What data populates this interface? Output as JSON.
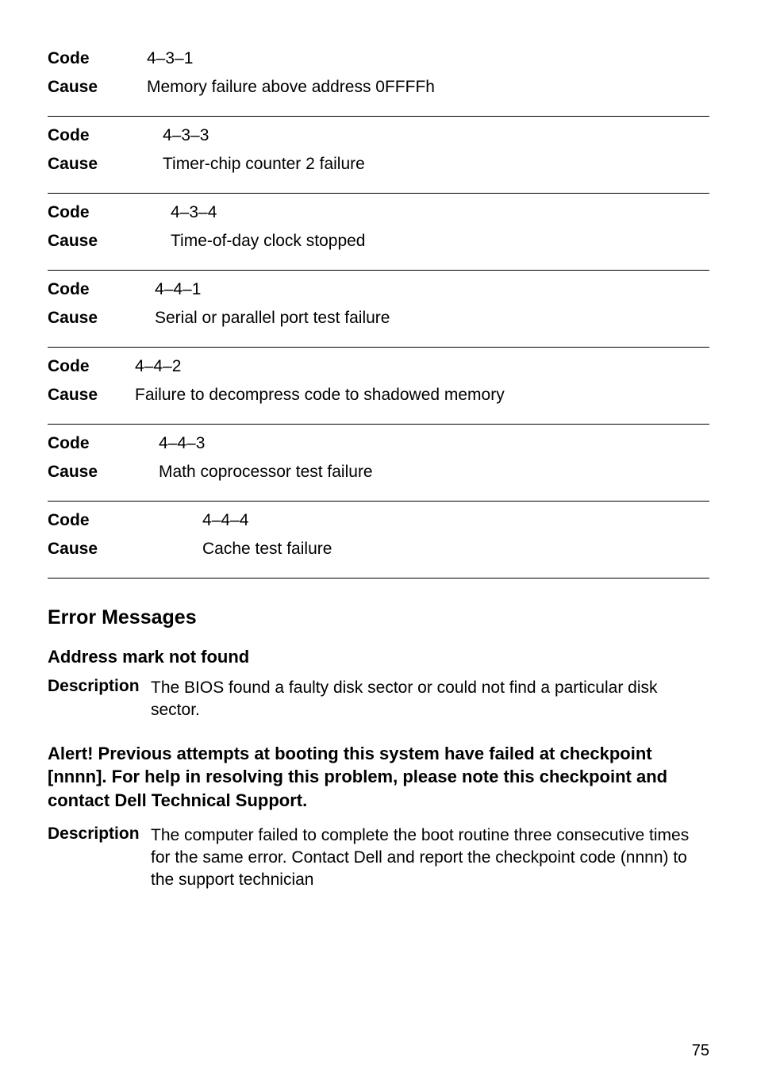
{
  "codes": [
    {
      "code_label": "Code",
      "code_value": "4–3–1",
      "cause_label": "Cause",
      "cause_value": "Memory failure above address 0FFFFh"
    },
    {
      "code_label": "Code",
      "code_value": "4–3–3",
      "cause_label": "Cause",
      "cause_value": "Timer-chip counter 2 failure"
    },
    {
      "code_label": "Code",
      "code_value": "4–3–4",
      "cause_label": "Cause",
      "cause_value": "Time-of-day clock stopped"
    },
    {
      "code_label": "Code",
      "code_value": "4–4–1",
      "cause_label": "Cause",
      "cause_value": "Serial or parallel port test failure"
    },
    {
      "code_label": "Code",
      "code_value": "4–4–2",
      "cause_label": "Cause",
      "cause_value": "Failure to decompress code to shadowed memory"
    },
    {
      "code_label": "Code",
      "code_value": "4–4–3",
      "cause_label": "Cause",
      "cause_value": "Math coprocessor test failure"
    },
    {
      "code_label": "Code",
      "code_value": "4–4–4",
      "cause_label": "Cause",
      "cause_value": "Cache test failure"
    }
  ],
  "heading": "Error Messages",
  "entry1": {
    "subheading": "Address mark not found",
    "desc_label": "Description",
    "desc_text": "The BIOS found a faulty disk sector or could not find a particular disk sector."
  },
  "entry2": {
    "subheading": "Alert! Previous attempts at booting this system have failed at checkpoint [nnnn]. For help in resolving this problem, please note this checkpoint and contact Dell Technical Support.",
    "desc_label": "Description",
    "desc_text": "The computer failed to complete the boot routine three consecutive times for the same error. Contact Dell and report the checkpoint code (nnnn) to the support technician"
  },
  "page_number": "75"
}
